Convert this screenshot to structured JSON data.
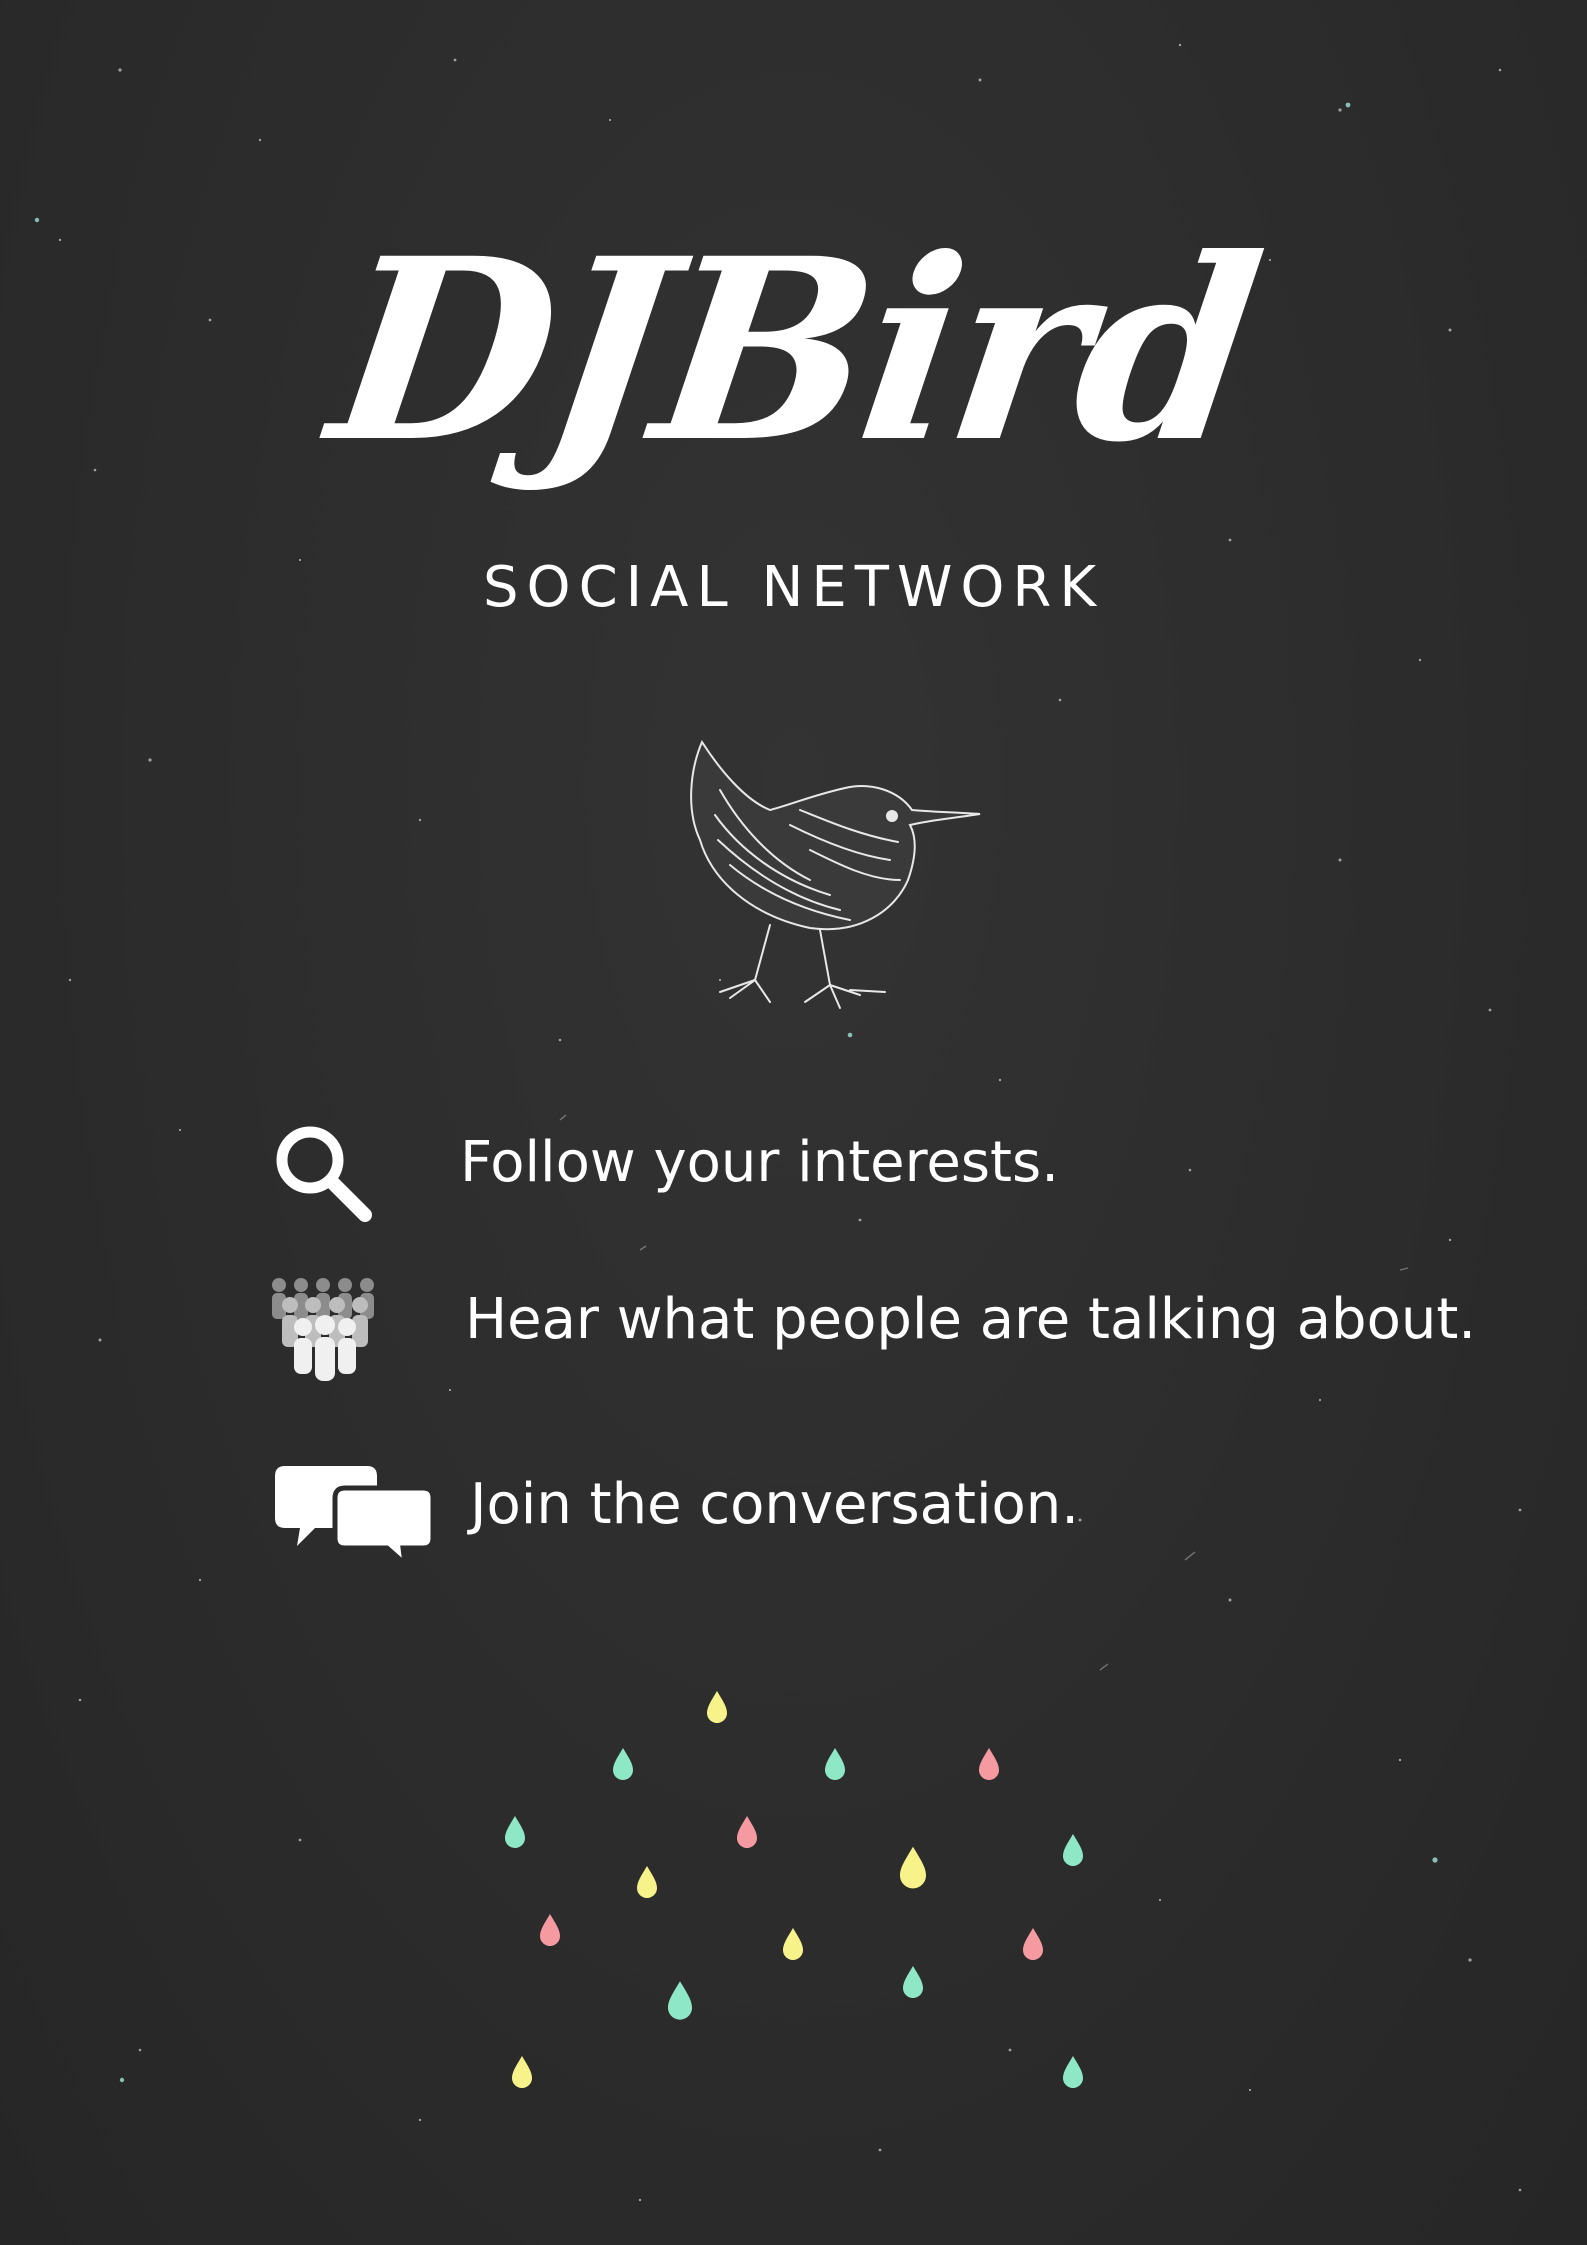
{
  "title": "DJBird",
  "subtitle": "SOCIAL NETWORK",
  "features": [
    {
      "icon": "magnifier-icon",
      "label": "Follow your interests."
    },
    {
      "icon": "crowd-icon",
      "label": "Hear what people are talking about."
    },
    {
      "icon": "chat-bubbles-icon",
      "label": "Join the conversation."
    }
  ],
  "colors": {
    "background": "#2b2b2b",
    "text": "#ffffff",
    "drop_yellow": "#f7f38a",
    "drop_mint": "#8ee8c8",
    "drop_pink": "#f59aa0"
  }
}
